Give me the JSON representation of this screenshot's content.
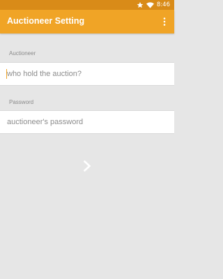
{
  "status_bar": {
    "time": "8:46",
    "icons": [
      "star-icon",
      "wifi-icon"
    ]
  },
  "app_bar": {
    "title": "Auctioneer Setting",
    "menu_icon": "more-vert-icon"
  },
  "form": {
    "auctioneer": {
      "label": "Auctioneer",
      "value": "",
      "placeholder": "who hold the auction?"
    },
    "password": {
      "label": "Password",
      "value": "",
      "placeholder": "auctioneer's password"
    },
    "next_icon": "chevron-right-icon"
  },
  "colors": {
    "status_bar": "#d98b18",
    "app_bar": "#f0a426",
    "background": "#e6e6e6",
    "field_background": "#ffffff"
  }
}
